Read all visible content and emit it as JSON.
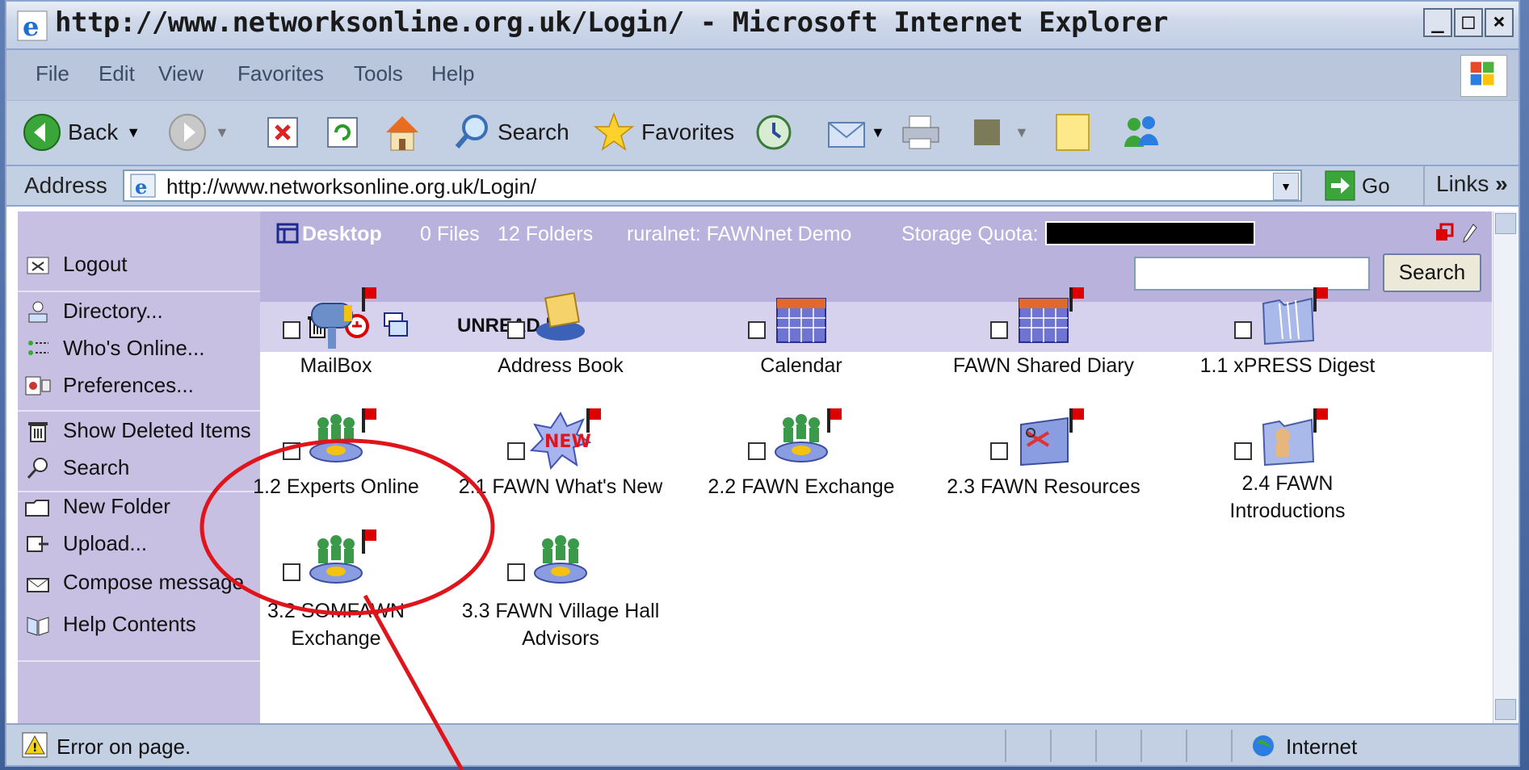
{
  "window": {
    "title": "http://www.networksonline.org.uk/Login/ - Microsoft Internet Explorer",
    "min": "_",
    "max": "□",
    "close": "×"
  },
  "menu": [
    "File",
    "Edit",
    "View",
    "Favorites",
    "Tools",
    "Help"
  ],
  "toolbar": {
    "back": "Back",
    "search": "Search",
    "favorites": "Favorites"
  },
  "address": {
    "label": "Address",
    "url": "http://www.networksonline.org.uk/Login/",
    "go": "Go",
    "links": "Links",
    "links_chevron": "»"
  },
  "header": {
    "desktop": "Desktop",
    "files": "0 Files",
    "folders": "12 Folders",
    "context": "ruralnet: FAWNnet Demo",
    "quota_label": "Storage Quota:",
    "search_value": "",
    "search_button": "Search"
  },
  "unread": {
    "label": "UNREAD |"
  },
  "sidebar": [
    {
      "label": "Logout",
      "icon": "logout-icon"
    },
    {
      "label": "Directory...",
      "icon": "directory-icon"
    },
    {
      "label": "Who's Online...",
      "icon": "users-online-icon"
    },
    {
      "label": "Preferences...",
      "icon": "preferences-icon"
    },
    {
      "label": "Show Deleted Items",
      "icon": "trash-icon"
    },
    {
      "label": "Search",
      "icon": "search-icon"
    },
    {
      "label": "New Folder",
      "icon": "new-folder-icon"
    },
    {
      "label": "Upload...",
      "icon": "upload-icon"
    },
    {
      "label": "Compose message",
      "icon": "compose-icon"
    },
    {
      "label": "Help Contents",
      "icon": "help-icon"
    }
  ],
  "items": [
    {
      "label": "MailBox",
      "icon": "mailbox-icon"
    },
    {
      "label": "Address Book",
      "icon": "address-book-icon"
    },
    {
      "label": "Calendar",
      "icon": "calendar-icon"
    },
    {
      "label": "FAWN Shared Diary",
      "icon": "calendar-icon"
    },
    {
      "label": "1.1 xPRESS Digest",
      "icon": "folder-icon"
    },
    {
      "label": "1.2 Experts Online",
      "icon": "group-icon"
    },
    {
      "label": "2.1 FAWN What's New",
      "icon": "new-burst-icon"
    },
    {
      "label": "2.2 FAWN Exchange",
      "icon": "group-icon"
    },
    {
      "label": "2.3 FAWN Resources",
      "icon": "resources-icon"
    },
    {
      "label": "2.4 FAWN\nIntroductions",
      "icon": "folder-person-icon"
    },
    {
      "label": "3.2 SOMFAWN\nExchange",
      "icon": "group-icon"
    },
    {
      "label": "3.3 FAWN Village Hall\nAdvisors",
      "icon": "group-icon"
    }
  ],
  "status": {
    "text": "Error on page.",
    "zone": "Internet"
  },
  "colors": {
    "sidebar_bg": "#c8c0e2",
    "header_bg": "#b9b2dd",
    "unread_bg": "#d6d2ee",
    "annotation": "#e0141b"
  }
}
